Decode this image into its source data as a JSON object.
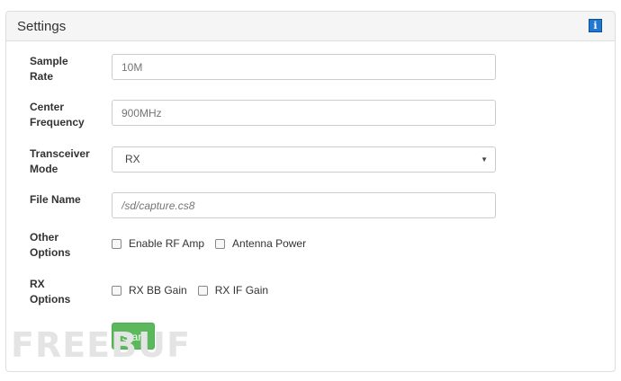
{
  "panel": {
    "title": "Settings",
    "info_icon_glyph": "i"
  },
  "form": {
    "sample_rate": {
      "label_line1": "Sample",
      "label_line2": "Rate",
      "placeholder": "10M"
    },
    "center_frequency": {
      "label_line1": "Center",
      "label_line2": "Frequency",
      "placeholder": "900MHz"
    },
    "transceiver_mode": {
      "label_line1": "Transceiver",
      "label_line2": "Mode",
      "selected": "RX"
    },
    "file_name": {
      "label": "File Name",
      "placeholder": "/sd/capture.cs8"
    },
    "other_options": {
      "label_line1": "Other",
      "label_line2": "Options",
      "checkboxes": [
        "Enable RF Amp",
        "Antenna Power"
      ]
    },
    "rx_options": {
      "label_line1": "RX",
      "label_line2": "Options",
      "checkboxes": [
        "RX BB Gain",
        "RX IF Gain"
      ]
    },
    "start_label": "Start"
  },
  "watermark": "FREEBUF",
  "colors": {
    "accent_info": "#1f78d1",
    "start_button": "#5cb85c"
  },
  "icons": {
    "info": "info-icon",
    "dropdown": "chevron-down-icon",
    "checkbox": "checkbox-icon"
  }
}
